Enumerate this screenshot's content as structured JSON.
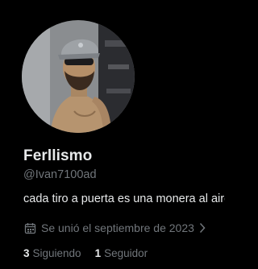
{
  "profile": {
    "display_name": "Ferllismo",
    "handle": "@Ivan7100ad",
    "bio": "cada tiro a puerta es una monera al aire",
    "joined": "Se unió el septiembre de 2023",
    "joined_icon": "calendar-icon",
    "avatar_icon": "avatar-photo"
  },
  "stats": {
    "following_count": "3",
    "following_label": "Siguiendo",
    "followers_count": "1",
    "followers_label": "Seguidor"
  },
  "colors": {
    "background": "#000000",
    "primary_text": "#e7e9ea",
    "secondary_text": "#71767b"
  }
}
